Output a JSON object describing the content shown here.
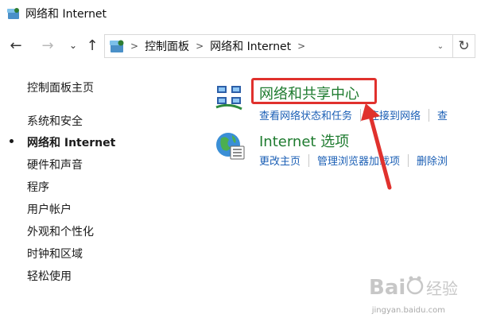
{
  "window": {
    "title": "网络和 Internet"
  },
  "nav": {
    "back_glyph": "←",
    "forward_glyph": "→",
    "recent_glyph": "⌄",
    "up_glyph": "↑"
  },
  "address": {
    "crumbs": [
      "控制面板",
      "网络和 Internet"
    ],
    "sep_glyph": ">",
    "dropdown_glyph": "⌄",
    "refresh_glyph": "↻"
  },
  "sidebar": {
    "items": [
      {
        "label": "控制面板主页"
      },
      {
        "label": "系统和安全"
      },
      {
        "label": "网络和 Internet",
        "active": true
      },
      {
        "label": "硬件和声音"
      },
      {
        "label": "程序"
      },
      {
        "label": "用户帐户"
      },
      {
        "label": "外观和个性化"
      },
      {
        "label": "时钟和区域"
      },
      {
        "label": "轻松使用"
      }
    ]
  },
  "categories": [
    {
      "title": "网络和共享中心",
      "icon": "network-sharing-center-icon",
      "links": [
        "查看网络状态和任务",
        "连接到网络",
        "查"
      ]
    },
    {
      "title": "Internet 选项",
      "icon": "internet-options-icon",
      "links": [
        "更改主页",
        "管理浏览器加载项",
        "删除浏"
      ]
    }
  ],
  "watermark": {
    "text": "Bai度 经验",
    "sub": "jingyan.baidu.com"
  },
  "colors": {
    "category_title": "#1e7b2f",
    "link": "#1b5fb5",
    "annotation": "#e0312d"
  }
}
